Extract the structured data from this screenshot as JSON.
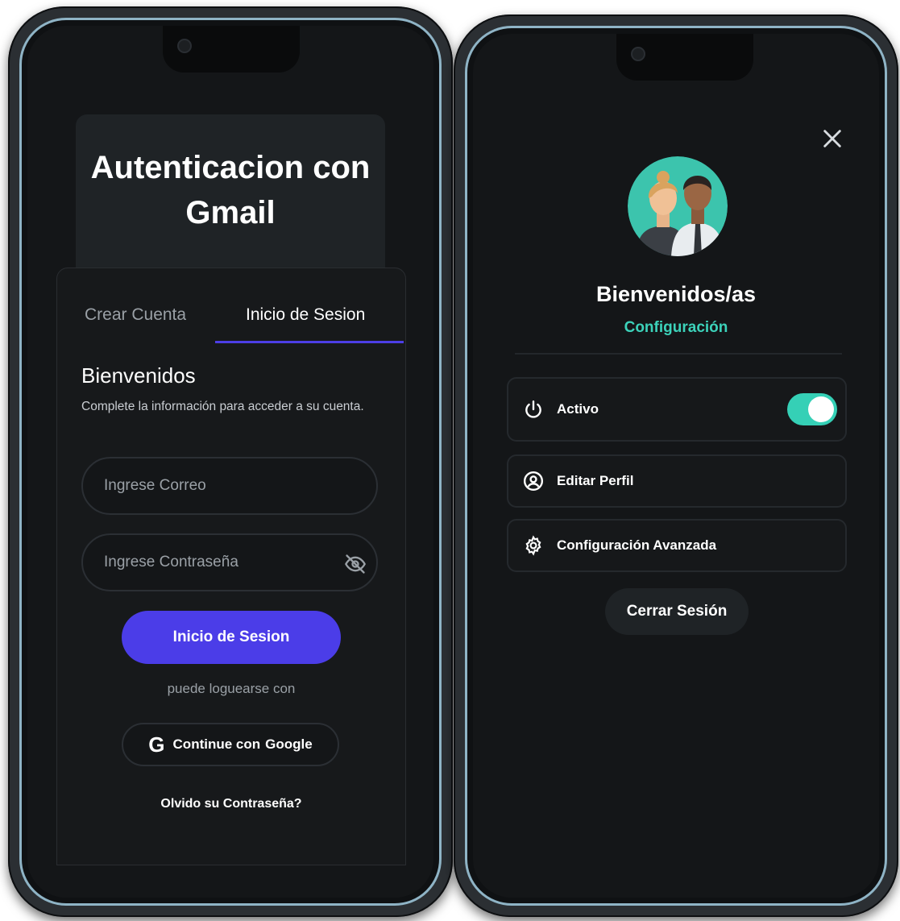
{
  "login_screen": {
    "title": "Autenticacion con Gmail",
    "tabs": [
      {
        "label": "Crear Cuenta",
        "active": false
      },
      {
        "label": "Inicio de Sesion",
        "active": true
      }
    ],
    "welcome_title": "Bienvenidos",
    "welcome_subtitle": "Complete la información para acceder a su cuenta.",
    "email_placeholder": "Ingrese Correo",
    "password_placeholder": "Ingrese Contraseña",
    "login_button": "Inicio de Sesion",
    "alt_login_text": "puede loguearse con",
    "google_button": {
      "icon": "G",
      "prefix": "Continue con",
      "provider": "Google"
    },
    "forgot_password": "Olvido su Contraseña?",
    "accent_color": "#4b3de8"
  },
  "profile_screen": {
    "greeting": "Bienvenidos/as",
    "settings_link": "Configuración",
    "menu": [
      {
        "label": "Activo",
        "icon": "power-icon",
        "toggle_on": true
      },
      {
        "label": "Editar Perfil",
        "icon": "user-circle-icon"
      },
      {
        "label": "Configuración Avanzada",
        "icon": "gear-icon"
      }
    ],
    "logout_button": "Cerrar Sesión",
    "accent_color": "#35d0b6"
  }
}
